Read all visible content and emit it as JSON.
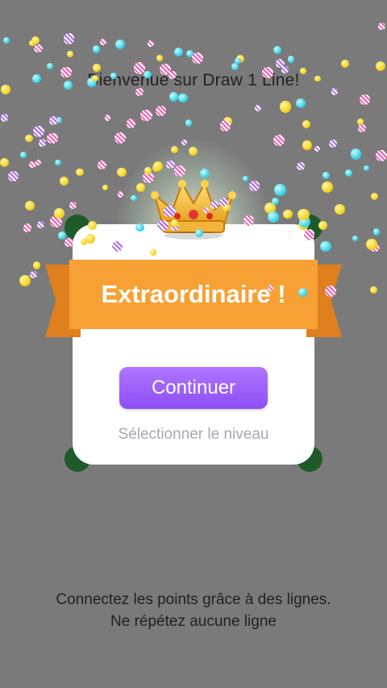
{
  "header": {
    "welcome_text": "Bienvenue sur Draw 1 Line!"
  },
  "dialog": {
    "title": "Extraordinaire !",
    "continue_label": "Continuer",
    "select_level_label": "Sélectionner le niveau"
  },
  "footer": {
    "instruction_line1": "Connectez les points grâce à des lignes.",
    "instruction_line2": "Ne répétez aucune ligne"
  },
  "colors": {
    "background": "#7a7a7a",
    "ribbon": "#f7a135",
    "button": "#9a5cf8",
    "confetti": [
      "#f5d524",
      "#3fd4e8",
      "#f05fb2",
      "#b06ae6"
    ]
  },
  "icons": [
    "crown-icon"
  ]
}
